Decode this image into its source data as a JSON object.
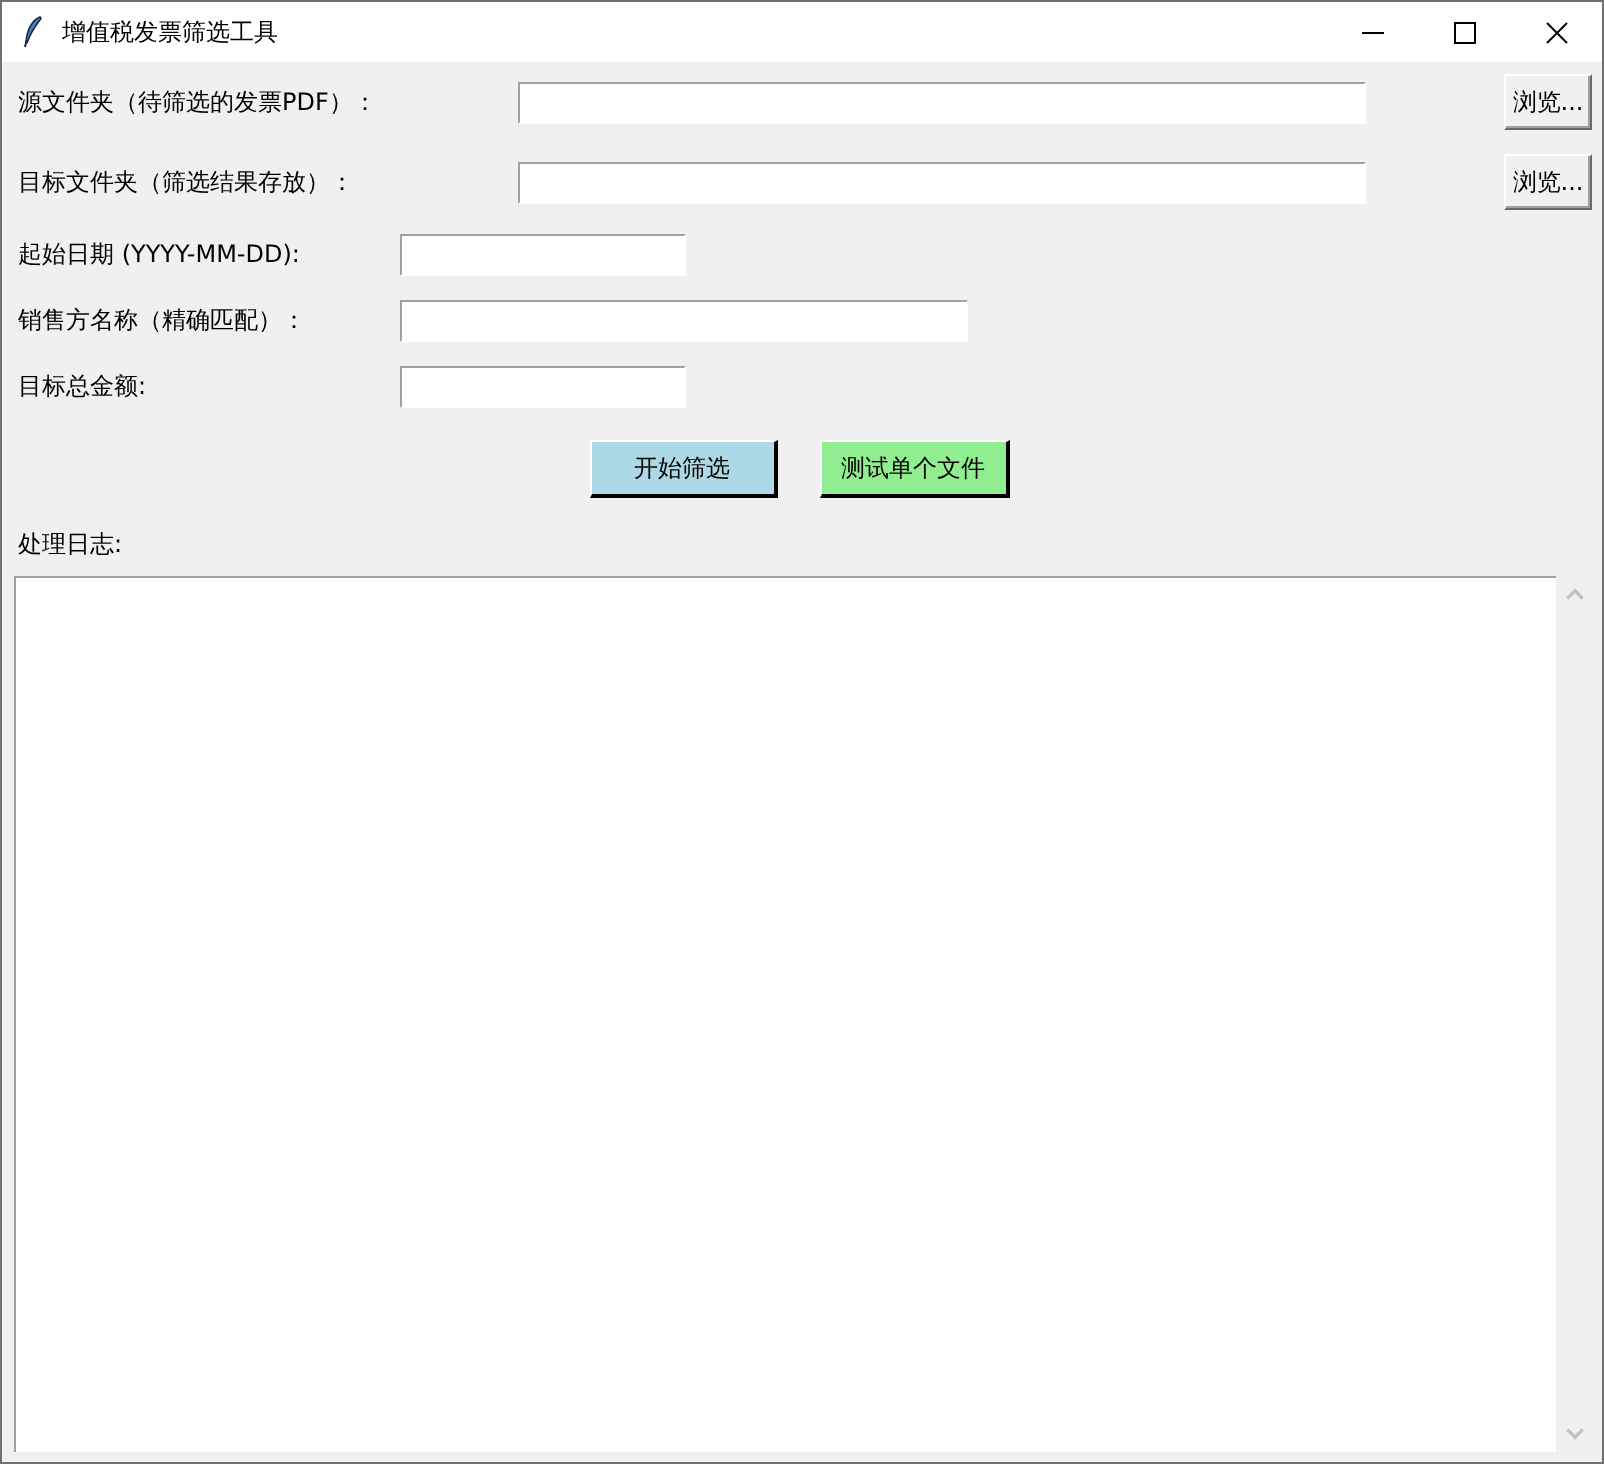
{
  "window": {
    "title": "增值税发票筛选工具"
  },
  "folder_fields": [
    {
      "label": "源文件夹（待筛选的发票PDF）：",
      "button": "浏览..."
    },
    {
      "label": "目标文件夹（筛选结果存放）：",
      "button": "浏览..."
    }
  ],
  "filter_fields": [
    {
      "label": "起始日期 (YYYY-MM-DD):",
      "kind": "short"
    },
    {
      "label": "销售方名称（精确匹配）：",
      "kind": "long"
    },
    {
      "label": "目标总金额:",
      "kind": "short"
    }
  ],
  "actions": [
    {
      "label": "开始筛选",
      "color": "#add8e6"
    },
    {
      "label": "测试单个文件",
      "color": "#90ee90"
    }
  ],
  "log": {
    "label": "处理日志:"
  }
}
